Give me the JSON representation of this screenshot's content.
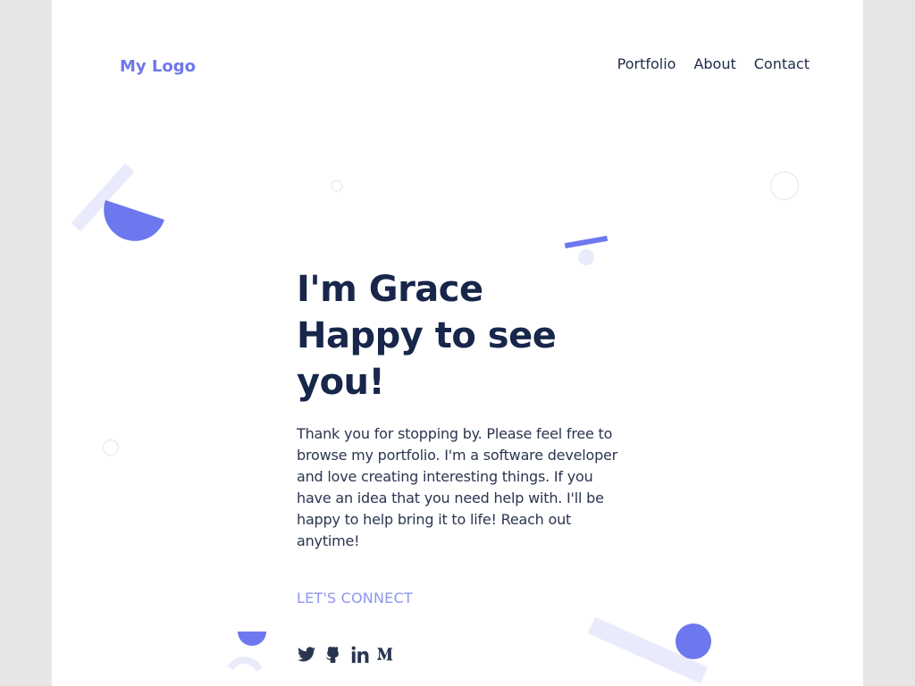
{
  "header": {
    "logo": "My Logo",
    "nav": [
      "Portfolio",
      "About",
      "Contact"
    ]
  },
  "hero": {
    "title_lines": [
      "I'm Grace",
      "Happy to see",
      "you!"
    ],
    "description": "Thank you for stopping by. Please feel free to browse my portfolio. I'm a software developer and love creating interesting things. If you have an idea that you need help with. I'll be happy to help bring it to life! Reach out anytime!",
    "cta": "LET'S CONNECT"
  },
  "socials": [
    "twitter-icon",
    "github-icon",
    "linkedin-icon",
    "medium-icon"
  ],
  "colors": {
    "accent": "#6d77ee",
    "accent_light": "#e9eafc",
    "heading": "#17264a",
    "body_text": "#2a3550",
    "cta": "#8e96f0",
    "outer_background": "#e6e6e6"
  }
}
